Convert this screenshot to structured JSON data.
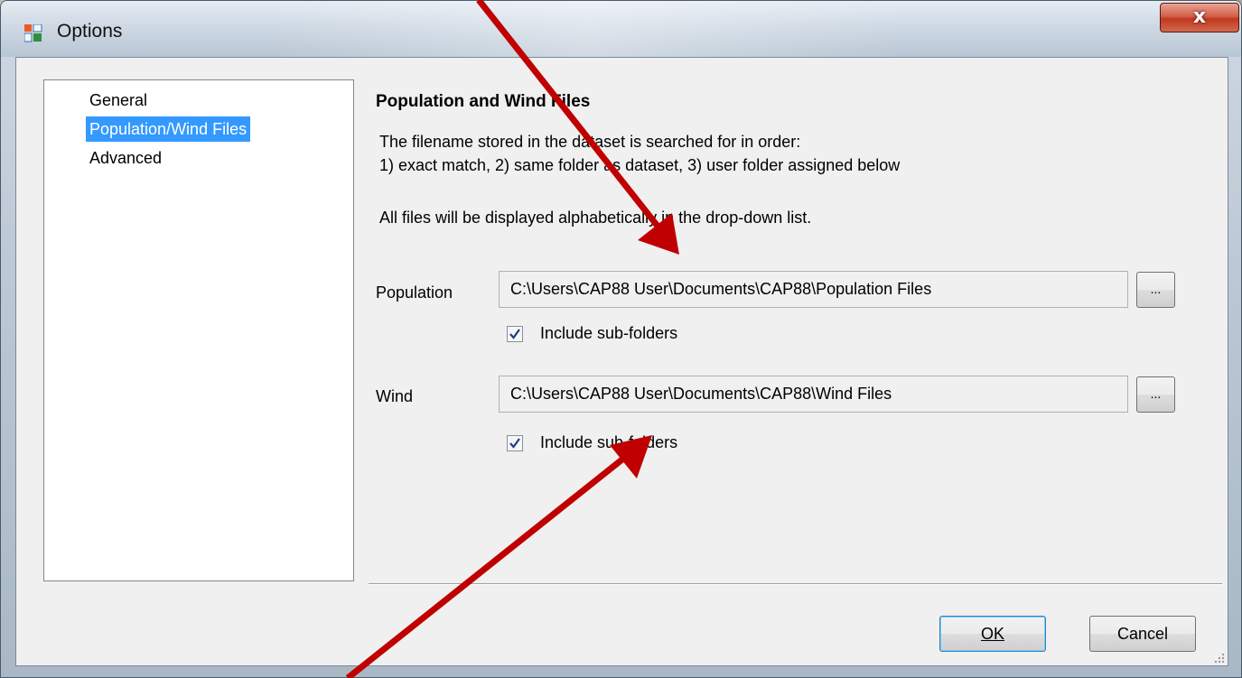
{
  "window": {
    "title": "Options",
    "close_label": "x"
  },
  "nav": {
    "items": [
      {
        "label": "General"
      },
      {
        "label": "Population/Wind Files",
        "selected": true
      },
      {
        "label": "Advanced"
      }
    ]
  },
  "panel": {
    "title": "Population and Wind Files",
    "desc_line1": "The filename stored in the dataset is searched for in order:",
    "desc_line2": "1) exact match, 2) same folder as dataset, 3) user folder assigned below",
    "desc_line3": "All files will be displayed alphabetically in the drop-down list.",
    "population": {
      "label": "Population",
      "path": "C:\\Users\\CAP88 User\\Documents\\CAP88\\Population Files",
      "browse_label": "...",
      "include_subfolders_label": "Include sub-folders",
      "include_subfolders_checked": true
    },
    "wind": {
      "label": "Wind",
      "path": "C:\\Users\\CAP88 User\\Documents\\CAP88\\Wind Files",
      "browse_label": "...",
      "include_subfolders_label": "Include sub-folders",
      "include_subfolders_checked": true
    }
  },
  "buttons": {
    "ok_label": "OK",
    "cancel_label": "Cancel"
  },
  "colors": {
    "selection": "#3399ff",
    "annotation_arrow": "#c00000",
    "close_button": "#c2381f"
  }
}
